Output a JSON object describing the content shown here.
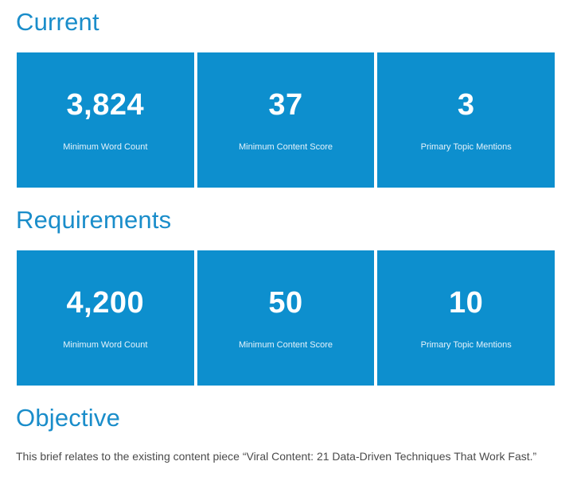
{
  "sections": {
    "current": {
      "title": "Current",
      "cards": [
        {
          "value": "3,824",
          "label": "Minimum Word Count"
        },
        {
          "value": "37",
          "label": "Minimum Content Score"
        },
        {
          "value": "3",
          "label": "Primary Topic Mentions"
        }
      ]
    },
    "requirements": {
      "title": "Requirements",
      "cards": [
        {
          "value": "4,200",
          "label": "Minimum Word Count"
        },
        {
          "value": "50",
          "label": "Minimum Content Score"
        },
        {
          "value": "10",
          "label": "Primary Topic Mentions"
        }
      ]
    },
    "objective": {
      "title": "Objective",
      "text": "This brief relates to the existing content piece “Viral Content: 21 Data-Driven Techniques That Work Fast.”"
    }
  },
  "colors": {
    "accent": "#1a8dca",
    "card_background": "#0d8fce",
    "card_text": "#ffffff",
    "body_text": "#4a4a4a"
  }
}
